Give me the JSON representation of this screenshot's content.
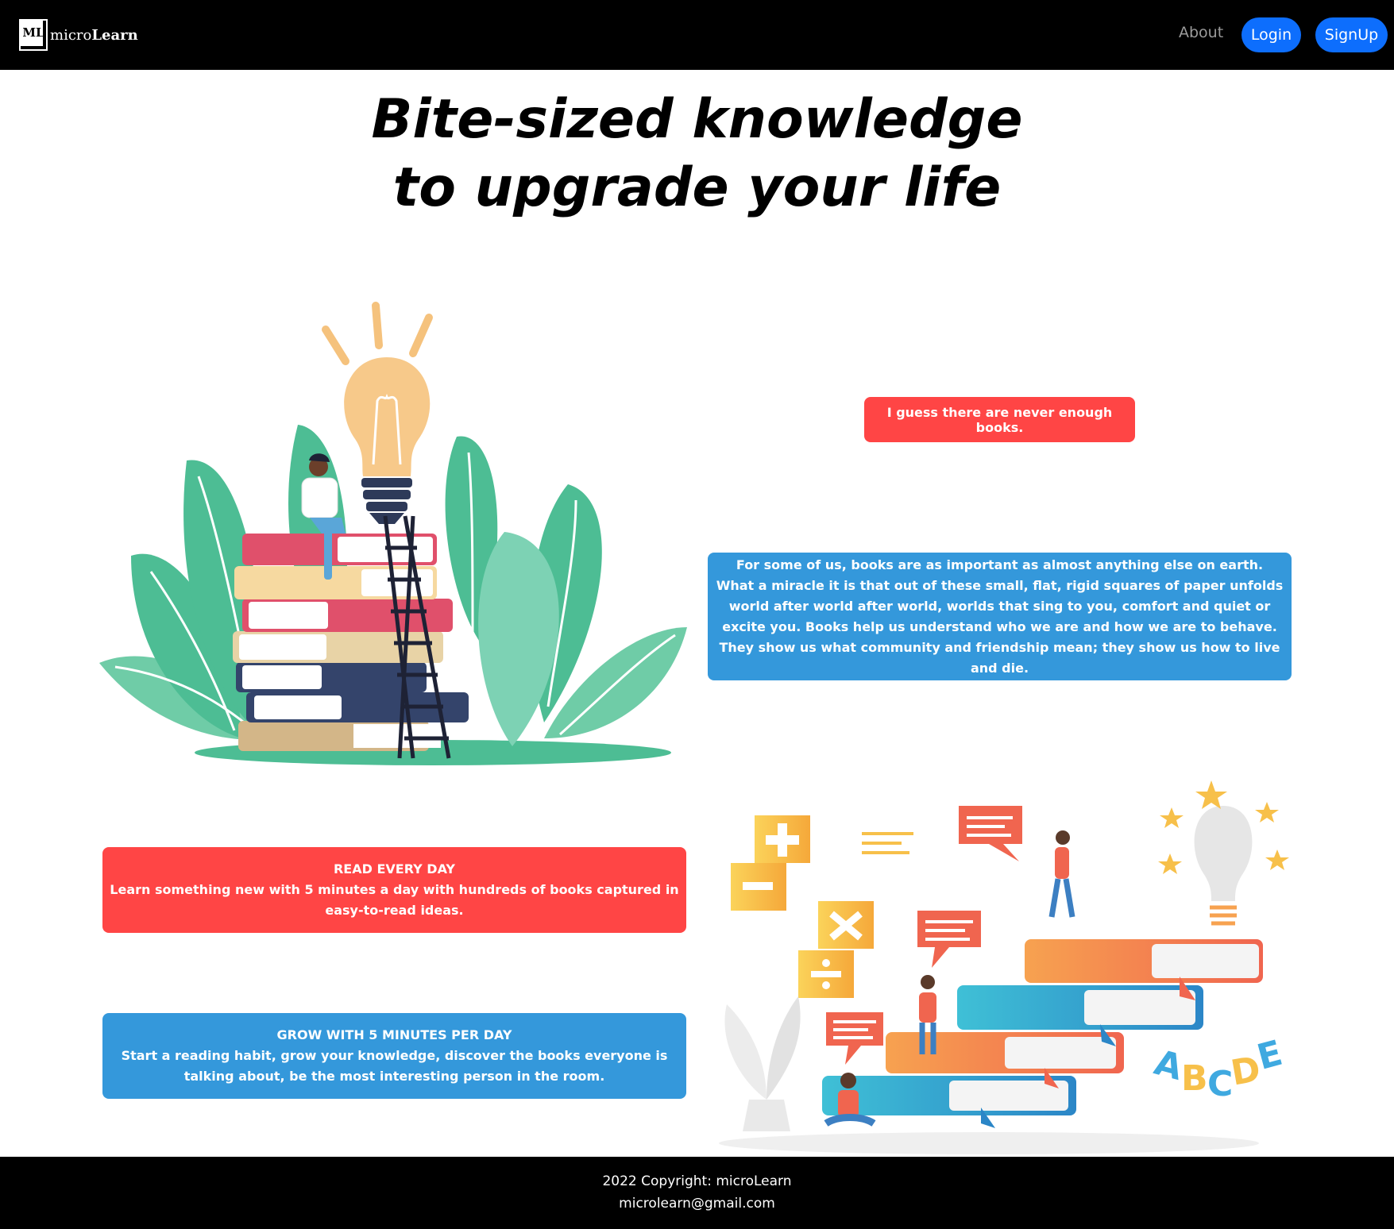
{
  "navbar": {
    "logo_mark": "ML",
    "brand_light": "micro",
    "brand_bold": "Learn",
    "about_label": "About",
    "login_label": "Login",
    "signup_label": "SignUp"
  },
  "hero": {
    "line1": "Bite-sized knowledge",
    "line2": "to upgrade your life"
  },
  "cards": {
    "quote": "I guess there are never enough books.",
    "long": "For some of us, books are as important as almost anything else on earth. What a miracle it is that out of these small, flat, rigid squares of paper unfolds world after world after world, worlds that sing to you, comfort and quiet or excite you. Books help us understand who we are and how we are to behave. They show us what community and friendship mean; they show us how to live and die.",
    "read_title": "READ EVERY DAY",
    "read_body": "Learn something new with 5 minutes a day with hundreds of books captured in easy-to-read ideas.",
    "grow_title": "GROW WITH 5 MINUTES PER DAY",
    "grow_body": "Start a reading habit, grow your knowledge, discover the books everyone is talking about, be the most interesting person in the room."
  },
  "illustration2": {
    "letters": [
      "A",
      "B",
      "C",
      "D",
      "E"
    ]
  },
  "footer": {
    "copyright": "2022 Copyright: microLearn",
    "email": "microlearn@gmail.com"
  },
  "colors": {
    "red": "#ff4545",
    "blue": "#3498db",
    "button": "#0d6efd"
  }
}
